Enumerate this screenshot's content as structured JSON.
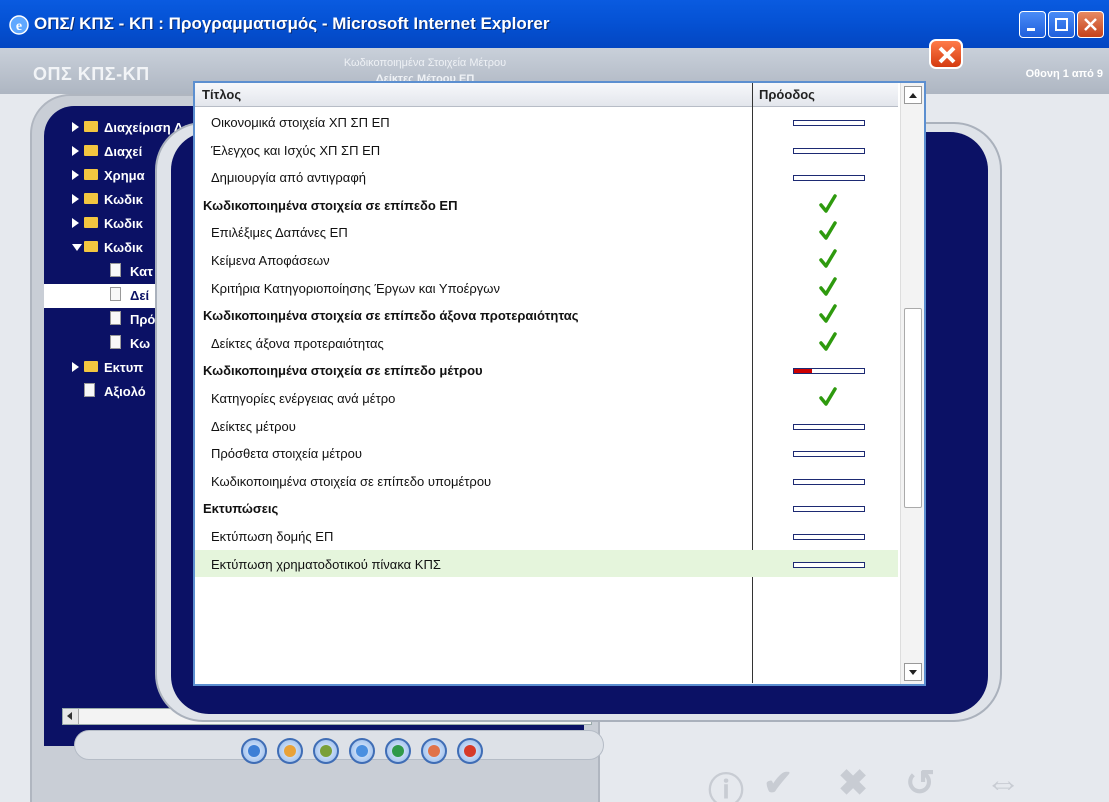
{
  "window": {
    "title": "ΟΠΣ/ ΚΠΣ - ΚΠ : Προγραμματισμός - Microsoft Internet Explorer"
  },
  "header": {
    "app_name": "ΟΠΣ ΚΠΣ-ΚΠ",
    "crumb1": "Κωδικοποιημένα Στοιχεία Μέτρου",
    "crumb2": "Δείκτες Μέτρου ΕΠ",
    "screen_indicator": "Οθονη 1 από 9"
  },
  "tree": {
    "items": [
      {
        "label": "Διαχείριση Δομής ΚΠΣ",
        "type": "folder",
        "level": 0,
        "open": false,
        "selected": false
      },
      {
        "label": "Διαχεί",
        "type": "folder",
        "level": 0,
        "open": false,
        "selected": false
      },
      {
        "label": "Χρημα",
        "type": "folder",
        "level": 0,
        "open": false,
        "selected": false
      },
      {
        "label": "Κωδικ",
        "type": "folder",
        "level": 0,
        "open": false,
        "selected": false
      },
      {
        "label": "Κωδικ",
        "type": "folder",
        "level": 0,
        "open": false,
        "selected": false
      },
      {
        "label": "Κωδικ",
        "type": "folder",
        "level": 0,
        "open": true,
        "selected": false
      },
      {
        "label": "Κατ",
        "type": "doc",
        "level": 1,
        "open": false,
        "selected": false
      },
      {
        "label": "Δεί",
        "type": "doc",
        "level": 1,
        "open": false,
        "selected": true
      },
      {
        "label": "Πρό",
        "type": "doc",
        "level": 1,
        "open": false,
        "selected": false
      },
      {
        "label": "Κω",
        "type": "doc",
        "level": 1,
        "open": false,
        "selected": false
      },
      {
        "label": "Εκτυπ",
        "type": "folder",
        "level": 0,
        "open": false,
        "selected": false
      },
      {
        "label": "Αξιολό",
        "type": "doc",
        "level": 0,
        "open": false,
        "selected": false
      }
    ]
  },
  "grid": {
    "col_title": "Τίτλος",
    "col_progress": "Πρόοδος",
    "rows": [
      {
        "title": "Οικονομικά στοιχεία ΧΠ ΣΠ ΕΠ",
        "bold": false,
        "status": "progress",
        "progress": 0
      },
      {
        "title": "Έλεγχος και Ισχύς ΧΠ ΣΠ ΕΠ",
        "bold": false,
        "status": "progress",
        "progress": 0
      },
      {
        "title": "Δημιουργία από αντιγραφή",
        "bold": false,
        "status": "progress",
        "progress": 0
      },
      {
        "title": "Κωδικοποιημένα στοιχεία σε επίπεδο ΕΠ",
        "bold": true,
        "status": "done",
        "progress": 1
      },
      {
        "title": "Επιλέξιμες Δαπάνες ΕΠ",
        "bold": false,
        "status": "done",
        "progress": 1
      },
      {
        "title": "Κείμενα Αποφάσεων",
        "bold": false,
        "status": "done",
        "progress": 1
      },
      {
        "title": "Κριτήρια Κατηγοριοποίησης Έργων και Υποέργων",
        "bold": false,
        "status": "done",
        "progress": 1
      },
      {
        "title": "Κωδικοποιημένα στοιχεία σε επίπεδο άξονα προτεραιότητας",
        "bold": true,
        "status": "done",
        "progress": 1
      },
      {
        "title": "Δείκτες άξονα προτεραιότητας",
        "bold": false,
        "status": "done",
        "progress": 1
      },
      {
        "title": "Κωδικοποιημένα στοιχεία σε επίπεδο μέτρου",
        "bold": true,
        "status": "progress",
        "progress": 0.25
      },
      {
        "title": "Κατηγορίες ενέργειας ανά μέτρο",
        "bold": false,
        "status": "done",
        "progress": 1
      },
      {
        "title": "Δείκτες μέτρου",
        "bold": false,
        "status": "progress",
        "progress": 0
      },
      {
        "title": "Πρόσθετα στοιχεία μέτρου",
        "bold": false,
        "status": "progress",
        "progress": 0
      },
      {
        "title": "Κωδικοποιημένα στοιχεία σε επίπεδο υπομέτρου",
        "bold": false,
        "status": "progress",
        "progress": 0
      },
      {
        "title": "Εκτυπώσεις",
        "bold": true,
        "status": "progress",
        "progress": 0
      },
      {
        "title": "Εκτύπωση δομής ΕΠ",
        "bold": false,
        "status": "progress",
        "progress": 0
      },
      {
        "title": "Εκτύπωση χρηματοδοτικού πίνακα ΚΠΣ",
        "bold": false,
        "status": "progress",
        "progress": 0,
        "highlighted": true
      }
    ]
  },
  "toolbar": {
    "tools": [
      "users-icon",
      "report-icon",
      "cube-icon",
      "magnifier-icon",
      "transfer-icon",
      "help-icon",
      "power-icon"
    ]
  },
  "colors": {
    "accent": "#0b1165",
    "title_bar": "#0553d6",
    "check": "#2e9a0e",
    "progress_fill": "#cc0000",
    "row_highlight": "#e5f5dc"
  }
}
